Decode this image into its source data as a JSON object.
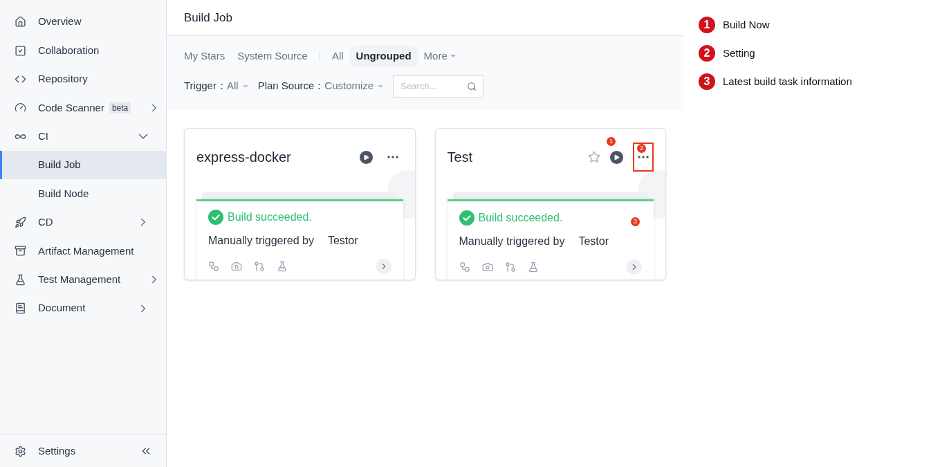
{
  "sidebar": {
    "items": [
      {
        "label": "Overview",
        "selected": false
      },
      {
        "label": "Collaboration",
        "selected": false
      },
      {
        "label": "Repository",
        "selected": false
      },
      {
        "label": "Code Scanner",
        "badge": "beta",
        "selected": false,
        "expanded": false
      },
      {
        "label": "CI",
        "selected": false,
        "expanded": true,
        "children": [
          {
            "label": "Build Job",
            "selected": true
          },
          {
            "label": "Build Node",
            "selected": false
          }
        ]
      },
      {
        "label": "CD",
        "selected": false,
        "expanded": false
      },
      {
        "label": "Artifact Management",
        "selected": false
      },
      {
        "label": "Test Management",
        "selected": false,
        "expanded": false
      },
      {
        "label": "Document",
        "selected": false,
        "expanded": false
      }
    ],
    "footer": {
      "label": "Settings"
    }
  },
  "header": {
    "title": "Build Job"
  },
  "tabs": [
    {
      "label": "My Stars",
      "selected": false
    },
    {
      "label": "System Source",
      "selected": false
    },
    {
      "label": "All",
      "selected": false
    },
    {
      "label": "Ungrouped",
      "selected": true
    },
    {
      "label": "More",
      "selected": false,
      "dropdown": true
    }
  ],
  "filters": [
    {
      "label": "Trigger：",
      "value": "All"
    },
    {
      "label": "Plan Source：",
      "value": "Customize"
    }
  ],
  "search": {
    "placeholder": "Search..."
  },
  "cards": [
    {
      "title": "express-docker",
      "more_highlighted": false,
      "build": {
        "succeeded": true,
        "message": "Build succeeded.",
        "trigger": "Manually triggered by",
        "user": "Testor"
      }
    },
    {
      "title": "Test",
      "starred": false,
      "more_highlighted": true,
      "markers": {
        "run": "1",
        "more": "2",
        "build": "3"
      },
      "build": {
        "succeeded": true,
        "message": "Build succeeded.",
        "trigger": "Manually triggered by",
        "user": "Testor"
      }
    }
  ],
  "legend": [
    {
      "number": "1",
      "label": "Build Now"
    },
    {
      "number": "2",
      "label": "Setting"
    },
    {
      "number": "3",
      "label": "Latest build task information"
    }
  ]
}
